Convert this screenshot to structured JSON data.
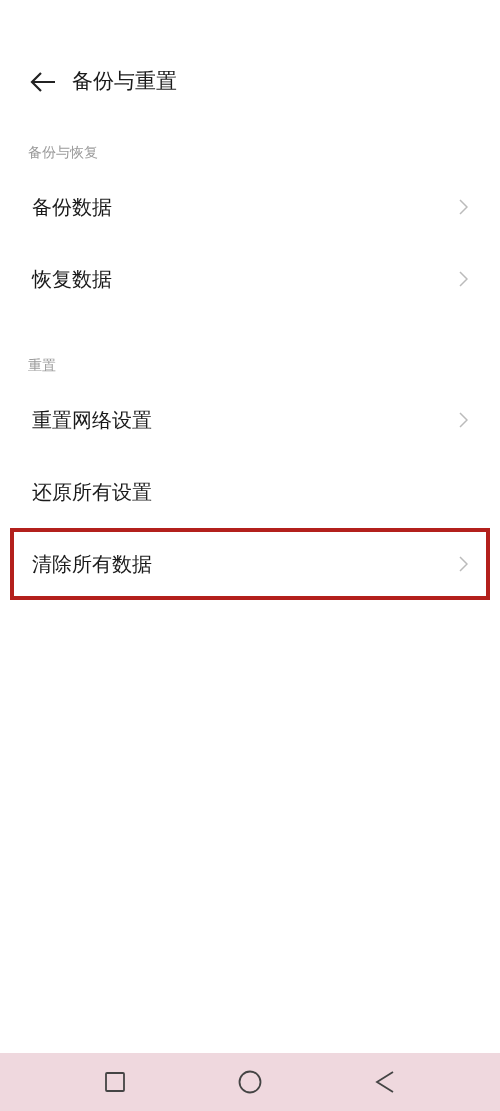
{
  "header": {
    "title": "备份与重置"
  },
  "sections": [
    {
      "header": "备份与恢复",
      "items": [
        {
          "label": "备份数据",
          "chevron": true,
          "highlighted": false
        },
        {
          "label": "恢复数据",
          "chevron": true,
          "highlighted": false
        }
      ]
    },
    {
      "header": "重置",
      "items": [
        {
          "label": "重置网络设置",
          "chevron": true,
          "highlighted": false
        },
        {
          "label": "还原所有设置",
          "chevron": false,
          "highlighted": false
        },
        {
          "label": "清除所有数据",
          "chevron": true,
          "highlighted": true
        }
      ]
    }
  ]
}
